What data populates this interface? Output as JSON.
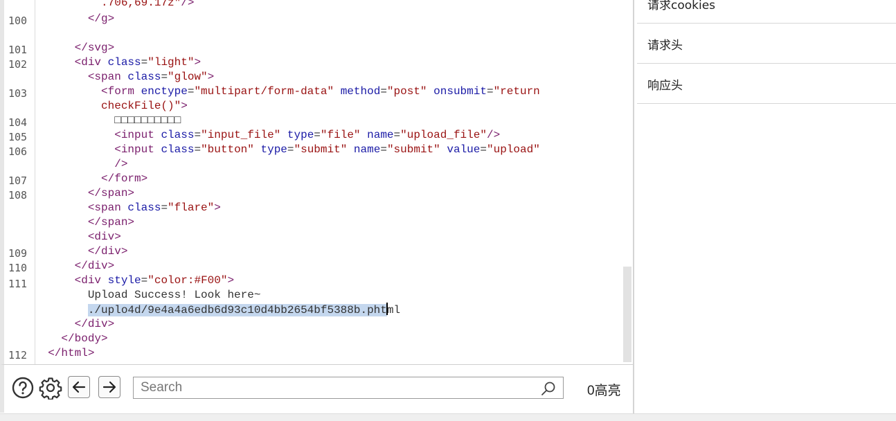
{
  "editor": {
    "line_numbers": [
      "100",
      "101",
      "102",
      "103",
      "104",
      "105",
      "106",
      "107",
      "108",
      "109",
      "110",
      "111",
      "112"
    ],
    "lines": [
      {
        "indent": "          ",
        "parts": [
          [
            "v",
            ".706,69.17z\""
          ],
          [
            "t",
            "/>"
          ]
        ]
      },
      {
        "indent": "        ",
        "parts": [
          [
            "t",
            "</"
          ],
          [
            "t",
            "g"
          ],
          [
            "t",
            ">"
          ]
        ]
      },
      {
        "indent": "      ",
        "parts": [
          [
            "t",
            "</"
          ],
          [
            "t",
            "svg"
          ],
          [
            "t",
            ">"
          ]
        ]
      },
      {
        "indent": "      ",
        "parts": [
          [
            "t",
            "<div "
          ],
          [
            "a",
            "class"
          ],
          [
            "p",
            "="
          ],
          [
            "v",
            "\"light\""
          ],
          [
            "t",
            ">"
          ]
        ]
      },
      {
        "indent": "        ",
        "parts": [
          [
            "t",
            "<span "
          ],
          [
            "a",
            "class"
          ],
          [
            "p",
            "="
          ],
          [
            "v",
            "\"glow\""
          ],
          [
            "t",
            ">"
          ]
        ]
      },
      {
        "indent": "          ",
        "parts": [
          [
            "t",
            "<form "
          ],
          [
            "a",
            "enctype"
          ],
          [
            "p",
            "="
          ],
          [
            "v",
            "\"multipart/form-data\""
          ],
          [
            "p",
            " "
          ],
          [
            "a",
            "method"
          ],
          [
            "p",
            "="
          ],
          [
            "v",
            "\"post\""
          ],
          [
            "p",
            " "
          ],
          [
            "a",
            "onsubmit"
          ],
          [
            "p",
            "="
          ],
          [
            "v",
            "\"return"
          ]
        ]
      },
      {
        "indent": "          ",
        "parts": [
          [
            "v",
            "checkFile()\""
          ],
          [
            "t",
            ">"
          ]
        ]
      },
      {
        "indent": "            ",
        "parts": [
          [
            "p",
            "□□□□□□□□□□"
          ]
        ]
      },
      {
        "indent": "            ",
        "parts": [
          [
            "t",
            "<input "
          ],
          [
            "a",
            "class"
          ],
          [
            "p",
            "="
          ],
          [
            "v",
            "\"input_file\""
          ],
          [
            "p",
            " "
          ],
          [
            "a",
            "type"
          ],
          [
            "p",
            "="
          ],
          [
            "v",
            "\"file\""
          ],
          [
            "p",
            " "
          ],
          [
            "a",
            "name"
          ],
          [
            "p",
            "="
          ],
          [
            "v",
            "\"upload_file\""
          ],
          [
            "t",
            "/>"
          ]
        ]
      },
      {
        "indent": "            ",
        "parts": [
          [
            "t",
            "<input "
          ],
          [
            "a",
            "class"
          ],
          [
            "p",
            "="
          ],
          [
            "v",
            "\"button\""
          ],
          [
            "p",
            " "
          ],
          [
            "a",
            "type"
          ],
          [
            "p",
            "="
          ],
          [
            "v",
            "\"submit\""
          ],
          [
            "p",
            " "
          ],
          [
            "a",
            "name"
          ],
          [
            "p",
            "="
          ],
          [
            "v",
            "\"submit\""
          ],
          [
            "p",
            " "
          ],
          [
            "a",
            "value"
          ],
          [
            "p",
            "="
          ],
          [
            "v",
            "\"upload\""
          ]
        ]
      },
      {
        "indent": "            ",
        "parts": [
          [
            "t",
            "/>"
          ]
        ]
      },
      {
        "indent": "          ",
        "parts": [
          [
            "t",
            "</"
          ],
          [
            "t",
            "form"
          ],
          [
            "t",
            ">"
          ]
        ]
      },
      {
        "indent": "        ",
        "parts": [
          [
            "t",
            "</"
          ],
          [
            "t",
            "span"
          ],
          [
            "t",
            ">"
          ]
        ]
      },
      {
        "indent": "        ",
        "parts": [
          [
            "t",
            "<span "
          ],
          [
            "a",
            "class"
          ],
          [
            "p",
            "="
          ],
          [
            "v",
            "\"flare\""
          ],
          [
            "t",
            ">"
          ]
        ]
      },
      {
        "indent": "        ",
        "parts": [
          [
            "t",
            "</"
          ],
          [
            "t",
            "span"
          ],
          [
            "t",
            ">"
          ]
        ]
      },
      {
        "indent": "        ",
        "parts": [
          [
            "t",
            "<div>"
          ]
        ]
      },
      {
        "indent": "        ",
        "parts": [
          [
            "t",
            "</"
          ],
          [
            "t",
            "div"
          ],
          [
            "t",
            ">"
          ]
        ]
      },
      {
        "indent": "      ",
        "parts": [
          [
            "t",
            "</"
          ],
          [
            "t",
            "div"
          ],
          [
            "t",
            ">"
          ]
        ]
      },
      {
        "indent": "      ",
        "parts": [
          [
            "t",
            "<div "
          ],
          [
            "a",
            "style"
          ],
          [
            "p",
            "="
          ],
          [
            "v",
            "\"color:#F00\""
          ],
          [
            "t",
            ">"
          ]
        ]
      },
      {
        "indent": "        ",
        "parts": [
          [
            "p",
            "Upload Success! Look here~"
          ]
        ]
      },
      {
        "indent": "        ",
        "parts": [
          [
            "hl",
            "./uplo4d/9e4a4a6edb6d93c10d4bb2654bf5388b.pht"
          ],
          [
            "cursor",
            ""
          ],
          [
            "p",
            "ml"
          ]
        ]
      },
      {
        "indent": "      ",
        "parts": [
          [
            "t",
            "</"
          ],
          [
            "t",
            "div"
          ],
          [
            "t",
            ">"
          ]
        ]
      },
      {
        "indent": "    ",
        "parts": [
          [
            "t",
            "</"
          ],
          [
            "t",
            "body"
          ],
          [
            "t",
            ">"
          ]
        ]
      },
      {
        "indent": "  ",
        "parts": [
          [
            "t",
            "</"
          ],
          [
            "t",
            "html"
          ],
          [
            "t",
            ">"
          ]
        ]
      }
    ]
  },
  "toolbar": {
    "help_icon": "question-circle-icon",
    "settings_icon": "gear-icon",
    "back_icon": "arrow-left-icon",
    "forward_icon": "arrow-right-icon",
    "search_placeholder": "Search",
    "search_value": "",
    "search_icon": "magnifier-icon",
    "highlight_count": "0高亮"
  },
  "sidepanel": {
    "items": [
      {
        "label": "请求cookies"
      },
      {
        "label": "请求头"
      },
      {
        "label": "响应头"
      }
    ]
  },
  "colors": {
    "tag": "#7a1e6c",
    "attr": "#1a1aa6",
    "value": "#991111",
    "selection": "#c4d7ee"
  }
}
